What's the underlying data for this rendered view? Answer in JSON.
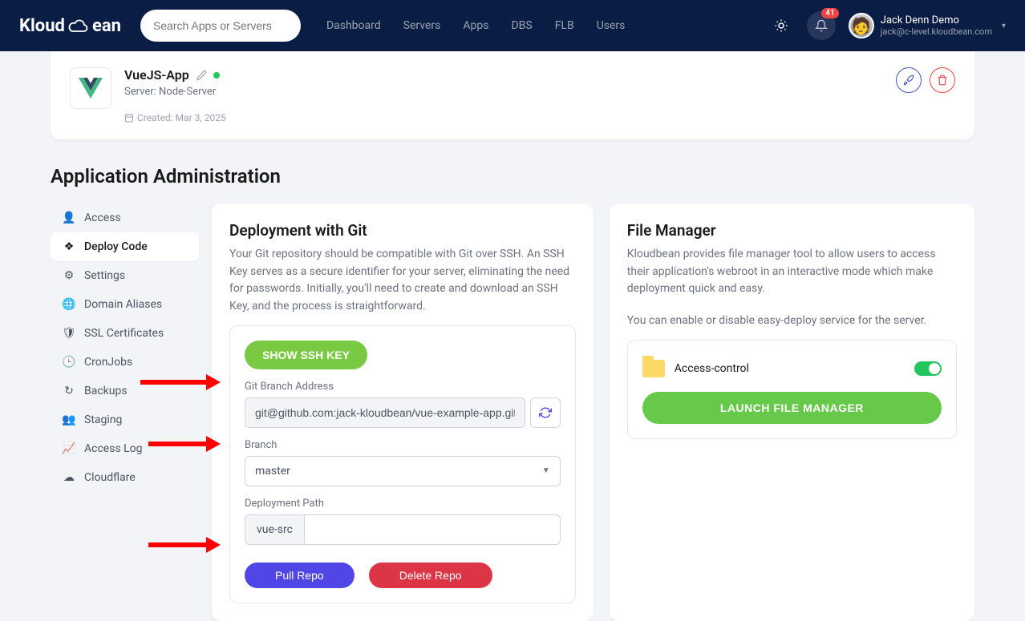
{
  "brand": "Kloudbean",
  "search": {
    "placeholder": "Search Apps or Servers"
  },
  "nav": {
    "dashboard": "Dashboard",
    "servers": "Servers",
    "apps": "Apps",
    "dbs": "DBS",
    "flb": "FLB",
    "users": "Users"
  },
  "notifications": {
    "count": "41"
  },
  "user": {
    "name": "Jack Denn Demo",
    "email": "jack@c-level.kloudbean.com"
  },
  "app": {
    "name": "VueJS-App",
    "server_label": "Server: Node-Server",
    "created": "Created: Mar 3, 2025"
  },
  "section_title": "Application Administration",
  "sidebar": {
    "items": [
      {
        "label": "Access"
      },
      {
        "label": "Deploy Code"
      },
      {
        "label": "Settings"
      },
      {
        "label": "Domain Aliases"
      },
      {
        "label": "SSL Certificates"
      },
      {
        "label": "CronJobs"
      },
      {
        "label": "Backups"
      },
      {
        "label": "Staging"
      },
      {
        "label": "Access Log"
      },
      {
        "label": "Cloudflare"
      }
    ]
  },
  "git": {
    "title": "Deployment with Git",
    "description": "Your Git repository should be compatible with Git over SSH. An SSH Key serves as a secure identifier for your server, eliminating the need for passwords. Initially, you'll need to create and download an SSH Key, and the process is straightforward.",
    "show_ssh": "SHOW SSH KEY",
    "branch_addr_label": "Git Branch Address",
    "branch_addr_value": "git@github.com:jack-kloudbean/vue-example-app.git",
    "branch_label": "Branch",
    "branch_value": "master",
    "path_label": "Deployment Path",
    "path_prefix": "vue-src",
    "pull": "Pull Repo",
    "delete": "Delete Repo"
  },
  "fm": {
    "title": "File Manager",
    "description": "Kloudbean provides file manager tool to allow users to access their application's webroot in an interactive mode which make deployment quick and easy.",
    "toggle_desc": "You can enable or disable easy-deploy service for the server.",
    "item": "Access-control",
    "launch": "LAUNCH FILE MANAGER"
  }
}
